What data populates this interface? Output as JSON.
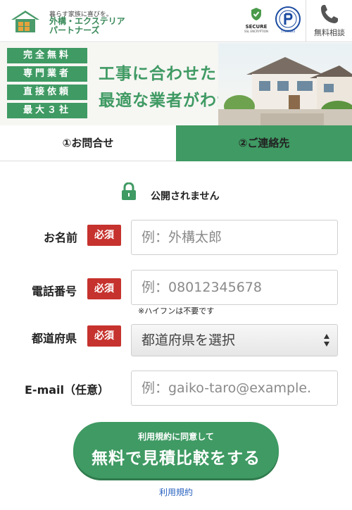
{
  "header": {
    "logo_tagline": "暮らす家族に喜びを。",
    "logo_name_line1": "外構・エクステリア",
    "logo_name_line2": "パートナーズ",
    "secure_label": "SECURE",
    "secure_sub": "SSL ENCRYPTION",
    "privacy_number": "17003883",
    "phone_label": "無料相談"
  },
  "banner": {
    "badges": [
      "完全無料",
      "専門業者",
      "直接依頼",
      "最大３社"
    ],
    "headline_line1": "工事に合わせた",
    "headline_line2": "最適な業者がわかる"
  },
  "steps": {
    "step1": "①お問合せ",
    "step2": "②ご連絡先"
  },
  "privacy_note": "公開されません",
  "form": {
    "required_label": "必須",
    "name": {
      "label": "お名前",
      "placeholder": "例：外構太郎"
    },
    "phone": {
      "label": "電話番号",
      "placeholder": "例：08012345678",
      "hint": "※ハイフンは不要です"
    },
    "prefecture": {
      "label": "都道府県",
      "selected": "都道府県を選択"
    },
    "email": {
      "label": "E-mail（任意）",
      "placeholder": "例：gaiko-taro@example."
    }
  },
  "submit": {
    "sub_label": "利用規約に同意して",
    "main_label": "無料で見積比較をする"
  },
  "terms_link": "利用規約",
  "colors": {
    "brand_green": "#3f9a63",
    "required_red": "#c6322d",
    "link_blue": "#2a63c0"
  }
}
